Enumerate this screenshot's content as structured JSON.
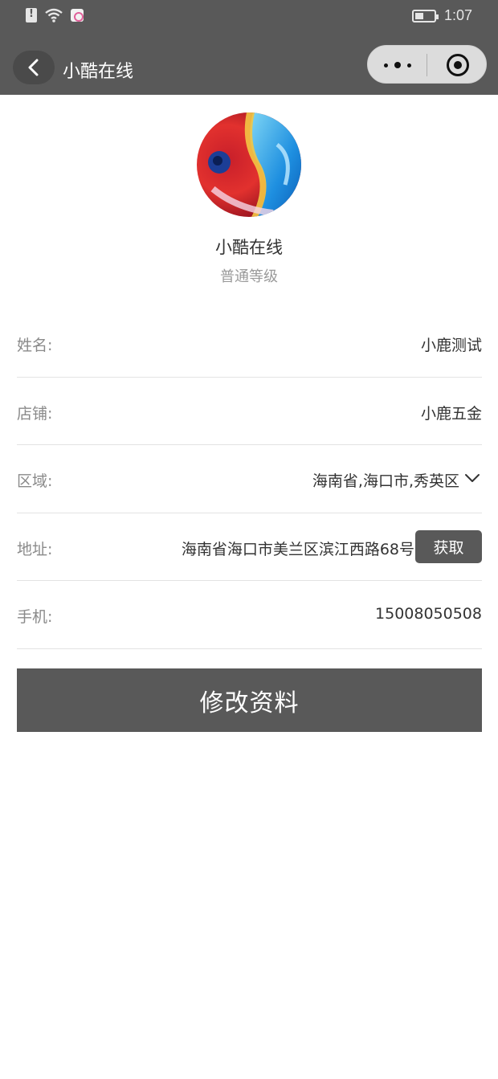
{
  "status_bar": {
    "time": "1:07",
    "icons": [
      "sim-alert-icon",
      "wifi-icon",
      "app-notification-icon",
      "battery-icon"
    ]
  },
  "nav": {
    "back_icon": "chevron-left-icon",
    "title": "小酷在线",
    "capsule_icons": [
      "more-dots-icon",
      "close-target-icon"
    ]
  },
  "profile": {
    "name": "小酷在线",
    "level": "普通等级"
  },
  "form": {
    "name": {
      "label": "姓名:",
      "value": "小鹿测试"
    },
    "shop": {
      "label": "店铺:",
      "value": "小鹿五金"
    },
    "region": {
      "label": "区域:",
      "value": "海南省,海口市,秀英区",
      "icon": "chevron-down-icon"
    },
    "address": {
      "label": "地址:",
      "value": "海南省海口市美兰区滨江西路68号",
      "button": "获取"
    },
    "phone": {
      "label": "手机:",
      "value": "15008050508"
    }
  },
  "submit_label": "修改资料",
  "colors": {
    "bar": "#595959",
    "button": "#595959",
    "label": "#8a8a8a",
    "divider": "#e3e3e3"
  }
}
